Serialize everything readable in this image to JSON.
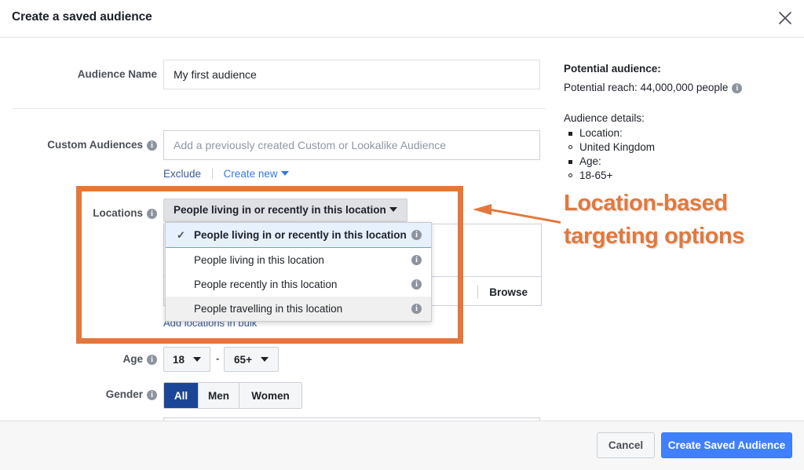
{
  "dialog": {
    "title": "Create a saved audience",
    "close_icon": "close-icon"
  },
  "form": {
    "audience_name": {
      "label": "Audience Name",
      "value": "My first audience"
    },
    "custom_audiences": {
      "label": "Custom Audiences",
      "placeholder": "Add a previously created Custom or Lookalike Audience",
      "exclude_link": "Exclude",
      "create_new_link": "Create new"
    },
    "locations": {
      "label": "Locations",
      "selected_option": "People living in or recently in this location",
      "browse_label": "Browse",
      "bulk_link": "Add locations in bulk",
      "options": [
        {
          "label": "People living in or recently in this location",
          "state": "selected"
        },
        {
          "label": "People living in this location",
          "state": "normal"
        },
        {
          "label": "People recently in this location",
          "state": "normal"
        },
        {
          "label": "People travelling in this location",
          "state": "hovered"
        }
      ],
      "check_glyph": "✓"
    },
    "age": {
      "label": "Age",
      "min": "18",
      "max": "65+",
      "separator": "-"
    },
    "gender": {
      "label": "Gender",
      "options": [
        "All",
        "Men",
        "Women"
      ],
      "selected": "All"
    }
  },
  "summary": {
    "title": "Potential audience:",
    "reach": "Potential reach: 44,000,000 people",
    "details_title": "Audience details:",
    "details": [
      {
        "marker": "square",
        "text": "Location:"
      },
      {
        "marker": "circle",
        "text": "United Kingdom"
      },
      {
        "marker": "square",
        "text": "Age:"
      },
      {
        "marker": "circle",
        "text": "18-65+"
      }
    ]
  },
  "footer": {
    "cancel": "Cancel",
    "submit": "Create Saved Audience"
  },
  "annotation": {
    "line1": "Location-based",
    "line2": "targeting options",
    "color": "#e3783c"
  }
}
